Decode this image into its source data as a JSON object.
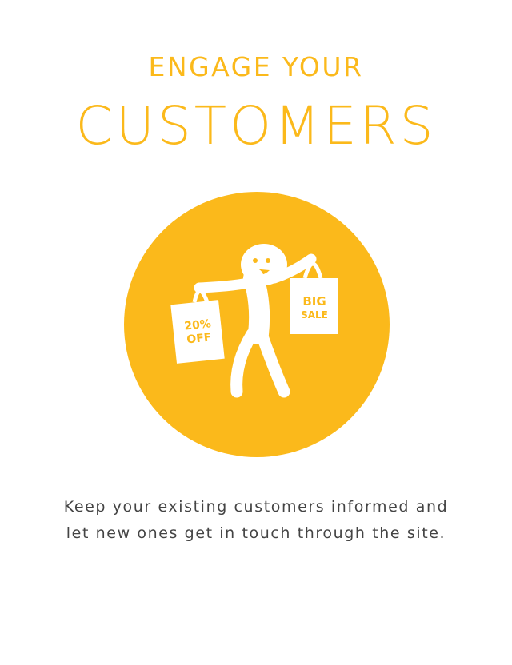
{
  "colors": {
    "accent": "#FBB91B",
    "text": "#444444",
    "background": "#FFFFFF"
  },
  "header": {
    "eyebrow": "ENGAGE YOUR",
    "title": "CUSTOMERS"
  },
  "illustration": {
    "icon": "happy-shopper-icon",
    "bag_left_label_line1": "20%",
    "bag_left_label_line2": "OFF",
    "bag_right_label_line1": "BIG",
    "bag_right_label_line2": "SALE"
  },
  "body": {
    "line1": "Keep your existing customers informed and",
    "line2": "let new ones get in touch through the site."
  }
}
